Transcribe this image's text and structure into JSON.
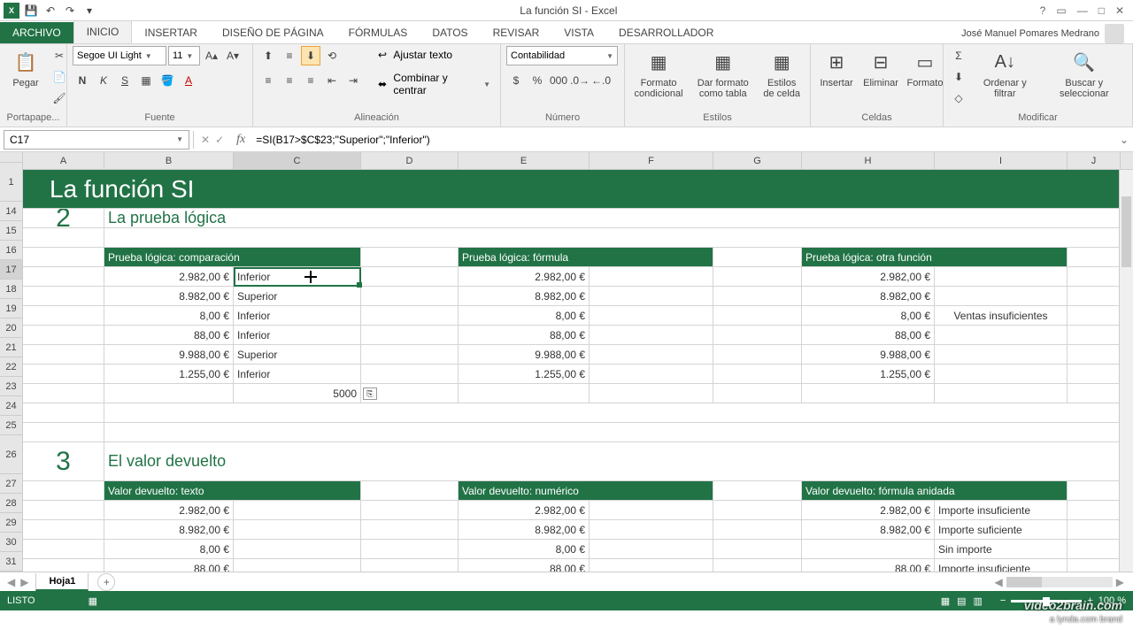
{
  "app": {
    "title": "La función SI - Excel",
    "user": "José Manuel Pomares Medrano"
  },
  "tabs": {
    "file": "ARCHIVO",
    "inicio": "INICIO",
    "insertar": "INSERTAR",
    "diseno": "DISEÑO DE PÁGINA",
    "formulas": "FÓRMULAS",
    "datos": "DATOS",
    "revisar": "REVISAR",
    "vista": "VISTA",
    "desarrollador": "DESARROLLADOR"
  },
  "ribbon": {
    "pegar": "Pegar",
    "portapapeles": "Portapape...",
    "fuente": "Fuente",
    "font_name": "Segoe UI Light",
    "font_size": "11",
    "alineacion": "Alineación",
    "ajustar": "Ajustar texto",
    "combinar": "Combinar y centrar",
    "numero": "Número",
    "formato_num": "Contabilidad",
    "estilos": "Estilos",
    "fc": "Formato condicional",
    "dft": "Dar formato como tabla",
    "ec": "Estilos de celda",
    "celdas": "Celdas",
    "insertar": "Insertar",
    "eliminar": "Eliminar",
    "formato": "Formato",
    "modificar": "Modificar",
    "ordenar": "Ordenar y filtrar",
    "buscar": "Buscar y seleccionar"
  },
  "namebox": "C17",
  "formula": "=SI(B17>$C$23;\"Superior\";\"Inferior\")",
  "cols": [
    "A",
    "B",
    "C",
    "D",
    "E",
    "F",
    "G",
    "H",
    "I",
    "J"
  ],
  "rows": [
    "1",
    "14",
    "15",
    "16",
    "17",
    "18",
    "19",
    "20",
    "21",
    "22",
    "23",
    "24",
    "25",
    "26",
    "27",
    "28",
    "29",
    "30",
    "31"
  ],
  "sheet": {
    "main_title": "La función SI",
    "sec2_num": "2",
    "sec2_title": "La prueba lógica",
    "hdr_comp": "Prueba lógica: comparación",
    "hdr_form": "Prueba lógica: fórmula",
    "hdr_otra": "Prueba lógica: otra función",
    "vals_b": [
      "2.982,00 €",
      "8.982,00 €",
      "8,00 €",
      "88,00 €",
      "9.988,00 €",
      "1.255,00 €"
    ],
    "vals_c": [
      "Inferior",
      "Superior",
      "Inferior",
      "Inferior",
      "Superior",
      "Inferior"
    ],
    "c23": "5000",
    "ventas_insuf": "Ventas insuficientes",
    "sec3_num": "3",
    "sec3_title": "El valor devuelto",
    "hdr_texto": "Valor devuelto: texto",
    "hdr_numer": "Valor devuelto: numérico",
    "hdr_anid": "Valor devuelto: fórmula anidada",
    "vals_b2": [
      "2.982,00 €",
      "8.982,00 €",
      "8,00 €",
      "88,00 €"
    ],
    "vals_i": [
      "Importe insuficiente",
      "Importe suficiente",
      "Sin importe",
      "Importe insuficiente"
    ]
  },
  "sheet_tab": "Hoja1",
  "status": {
    "ready": "LISTO",
    "zoom": "100 %"
  }
}
